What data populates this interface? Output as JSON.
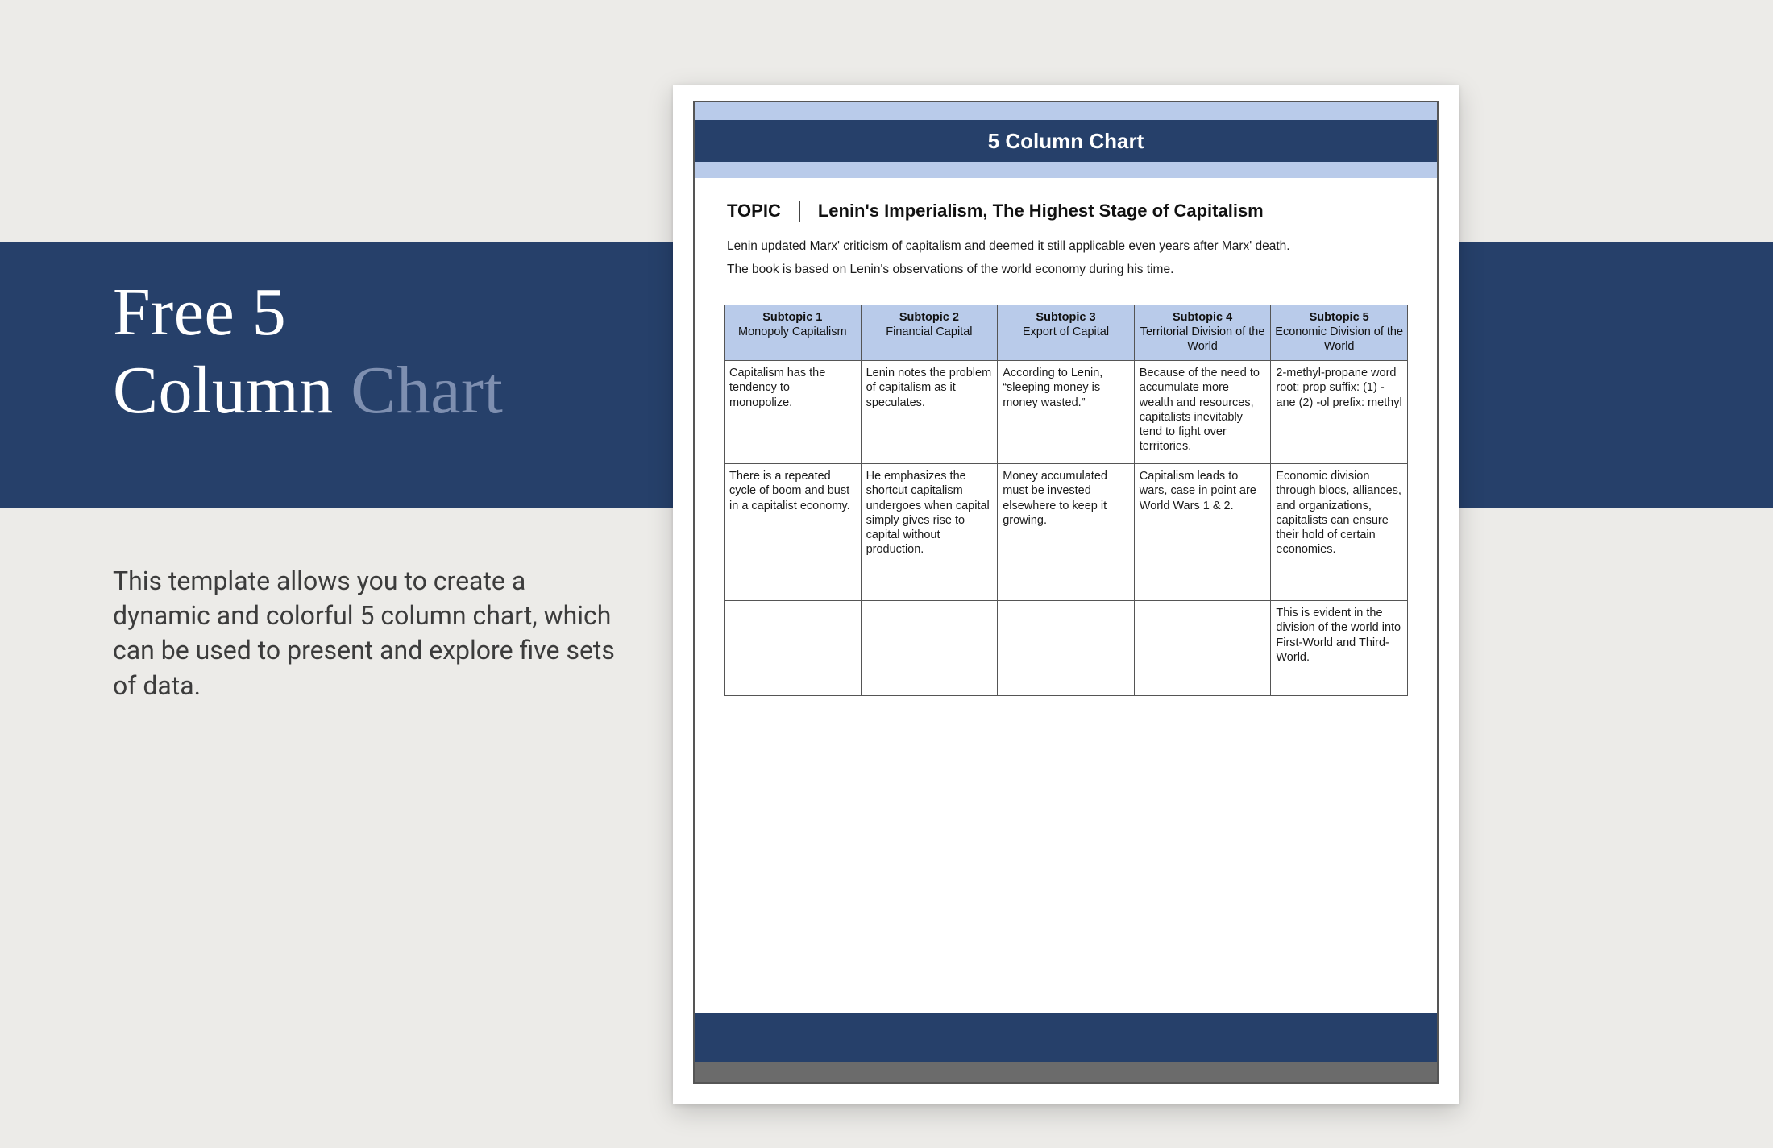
{
  "hero": {
    "title_line1": "Free 5",
    "title_line2a": "Column ",
    "title_line2b": "Chart",
    "description": "This template allows you to create a dynamic and colorful 5 column chart, which can be used to present and explore five sets of data."
  },
  "doc": {
    "banner_title": "5 Column Chart",
    "topic_label": "TOPIC",
    "topic_title": "Lenin's Imperialism, The Highest Stage of Capitalism",
    "intro_p1": "Lenin updated Marx' criticism of capitalism and deemed it still applicable even years after Marx' death.",
    "intro_p2": "The book is based on Lenin's observations of the world economy during his time."
  },
  "chart_data": {
    "type": "table",
    "columns": [
      {
        "label": "Subtopic 1",
        "name": "Monopoly Capitalism"
      },
      {
        "label": "Subtopic 2",
        "name": "Financial Capital"
      },
      {
        "label": "Subtopic 3",
        "name": "Export of Capital"
      },
      {
        "label": "Subtopic 4",
        "name": "Territorial Division of the World"
      },
      {
        "label": "Subtopic 5",
        "name": "Economic Division of the World"
      }
    ],
    "rows": [
      [
        "Capitalism has the tendency to monopolize.",
        "Lenin notes the problem of capitalism as it speculates.",
        "According to Lenin, “sleeping money is money wasted.”",
        "Because of the need to accumulate more wealth and resources, capitalists inevitably tend to fight over territories.",
        "2-methyl-propane word root: prop suffix: (1) -ane (2) -ol prefix: methyl"
      ],
      [
        "There is a repeated cycle of boom and bust in a capitalist economy.",
        "He emphasizes the shortcut capitalism undergoes when capital simply gives rise to capital without production.",
        "Money accumulated must be invested elsewhere to keep it growing.",
        "Capitalism leads to wars, case in point are World Wars 1 & 2.",
        "Economic division through blocs, alliances, and organizations, capitalists can ensure their hold of certain economies."
      ],
      [
        "",
        "",
        "",
        "",
        "This is evident in the division of the world into First-World and Third-World."
      ]
    ]
  }
}
